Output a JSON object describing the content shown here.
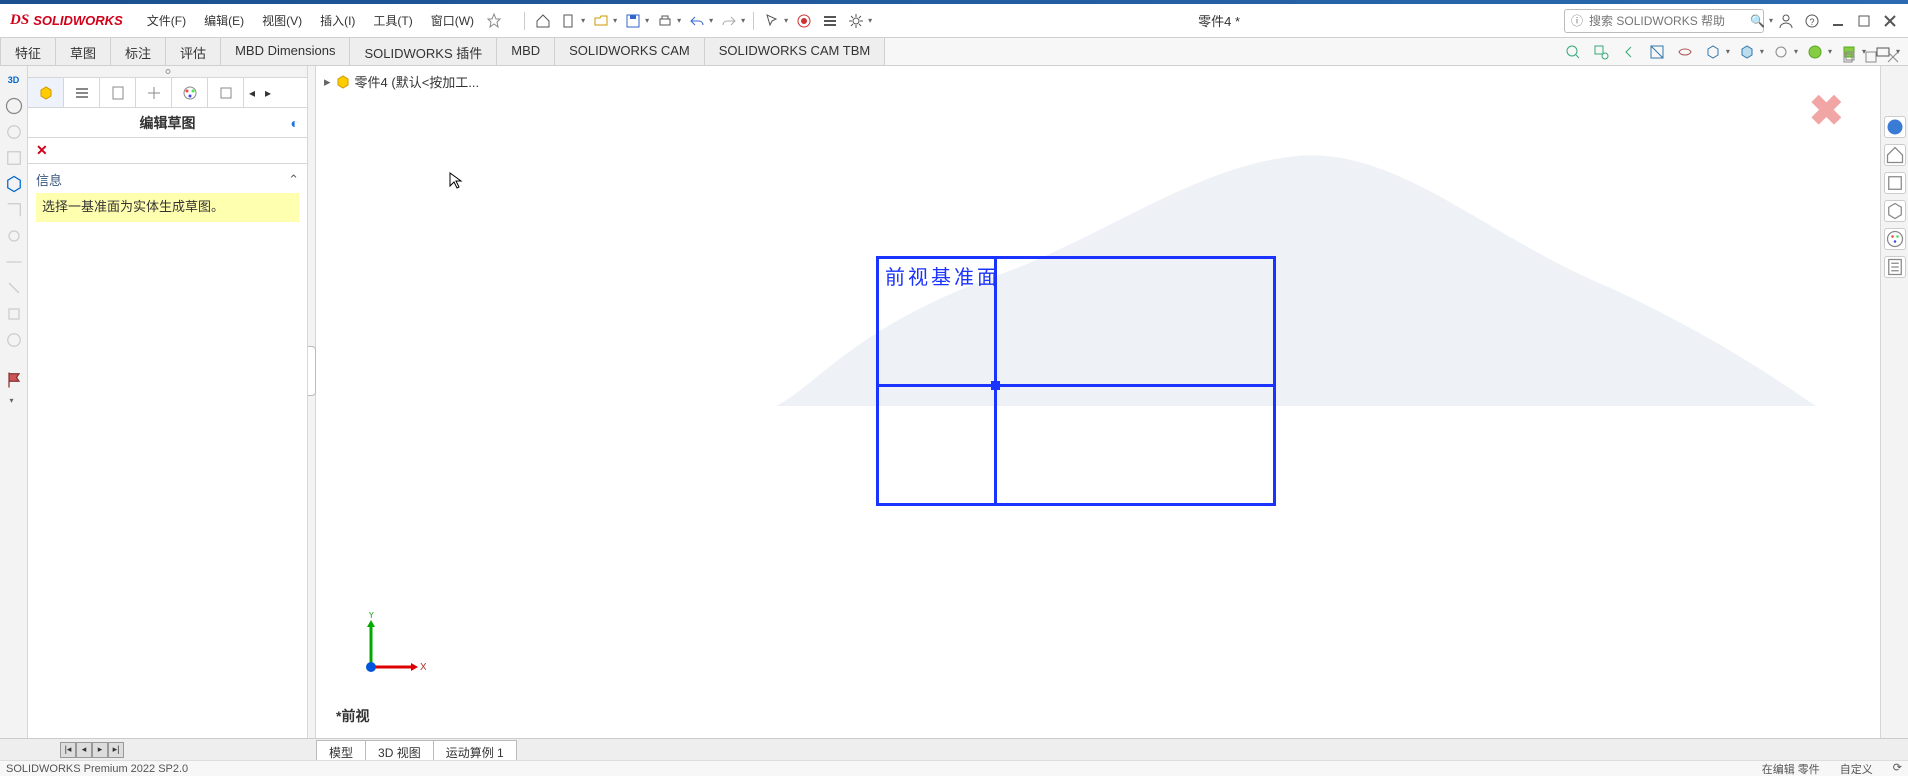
{
  "app": {
    "name": "SOLIDWORKS",
    "logo_prefix": "DS"
  },
  "menus": [
    "文件(F)",
    "编辑(E)",
    "视图(V)",
    "插入(I)",
    "工具(T)",
    "窗口(W)"
  ],
  "document_title": "零件4 *",
  "search_placeholder": "搜索 SOLIDWORKS 帮助",
  "ribbon_tabs": [
    "特征",
    "草图",
    "标注",
    "评估",
    "MBD Dimensions",
    "SOLIDWORKS 插件",
    "MBD",
    "SOLIDWORKS CAM",
    "SOLIDWORKS CAM TBM"
  ],
  "breadcrumb": "零件4 (默认<按加工...",
  "panel": {
    "title": "编辑草图",
    "section_header": "信息",
    "info_message": "选择一基准面为实体生成草图。"
  },
  "plane_label": "前视基准面",
  "view_label": "*前视",
  "axis": {
    "x": "X",
    "y": "Y"
  },
  "bottom_tabs": [
    "模型",
    "3D 视图",
    "运动算例 1"
  ],
  "status": {
    "left": "SOLIDWORKS Premium 2022 SP2.0",
    "right1": "在编辑 零件",
    "right2": "自定义"
  },
  "colors": {
    "brand": "#d0021b",
    "plane": "#1a33ff",
    "highlight": "#ffffb0"
  }
}
